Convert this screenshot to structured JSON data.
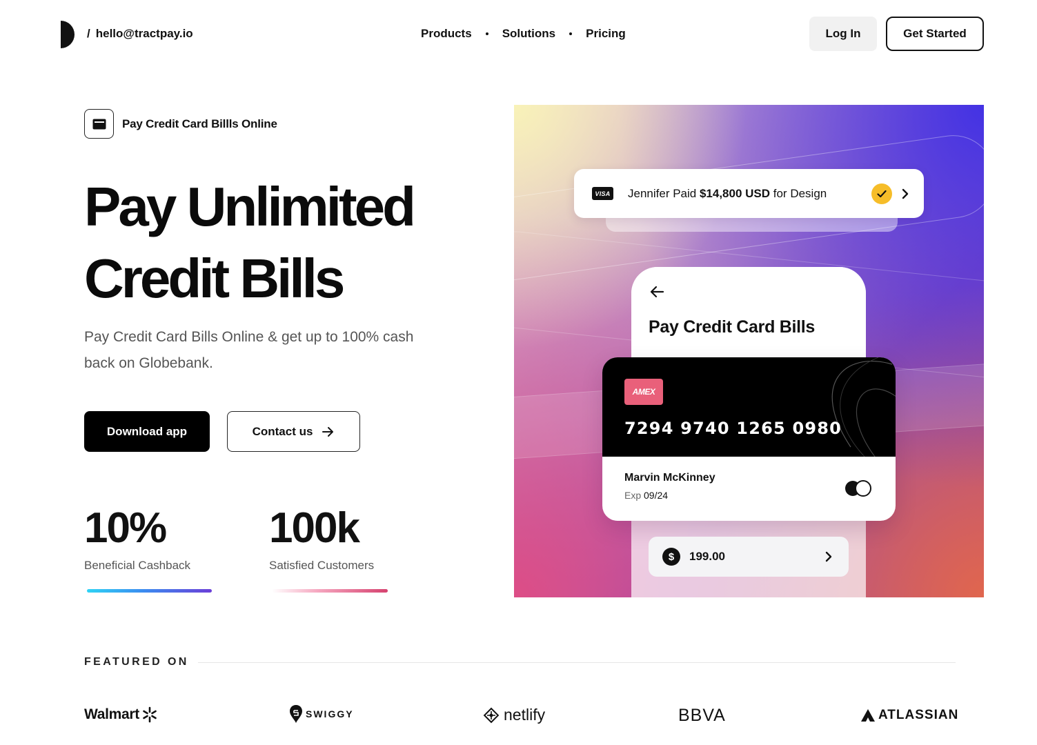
{
  "header": {
    "email_slash": "/",
    "email": "hello@tractpay.io",
    "nav": [
      {
        "label": "Products"
      },
      {
        "label": "Solutions"
      },
      {
        "label": "Pricing"
      }
    ],
    "login_label": "Log In",
    "get_started_label": "Get Started"
  },
  "hero": {
    "tagline": "Pay Credit Card Billls Online",
    "headline_line1": "Pay Unlimited",
    "headline_line2": "Credit Bills",
    "subtitle": "Pay Credit Card Bills Online & get up to 100% cash back on Globebank.",
    "download_label": "Download app",
    "contact_label": "Contact us",
    "stats": [
      {
        "value": "10%",
        "label": "Beneficial Cashback"
      },
      {
        "value": "100k",
        "label": "Satisfied Customers"
      }
    ]
  },
  "panel": {
    "notification": {
      "card_brand": "VISA",
      "prefix": "Jennifer Paid ",
      "amount": "$14,800 USD",
      "suffix": " for Design"
    },
    "phone_title": "Pay Credit Card Bills",
    "card": {
      "brand": "AMEX",
      "number": "7294 9740 1265 0980",
      "holder": "Marvin McKinney",
      "exp_label": "Exp",
      "exp_value": "09/24"
    },
    "amount": "199.00",
    "currency_symbol": "$"
  },
  "featured": {
    "label": "FEATURED ON",
    "brands": [
      "Walmart",
      "SWIGGY",
      "netlify",
      "BBVA",
      "ATLASSIAN"
    ]
  },
  "colors": {
    "primary": "#000000",
    "check": "#f6bd29",
    "amex": "#e9607a",
    "stat_bar_1_end": "#6b3fd8",
    "stat_bar_2_end": "#d6426f"
  },
  "icons": [
    "logo-icon",
    "wallet-icon",
    "arrow-right-icon",
    "visa-icon",
    "check-icon",
    "chevron-right-icon",
    "arrow-left-icon",
    "amex-icon",
    "mastercard-icon",
    "dollar-icon",
    "walmart-spark-icon",
    "swiggy-pin-icon",
    "netlify-icon",
    "atlassian-icon"
  ]
}
